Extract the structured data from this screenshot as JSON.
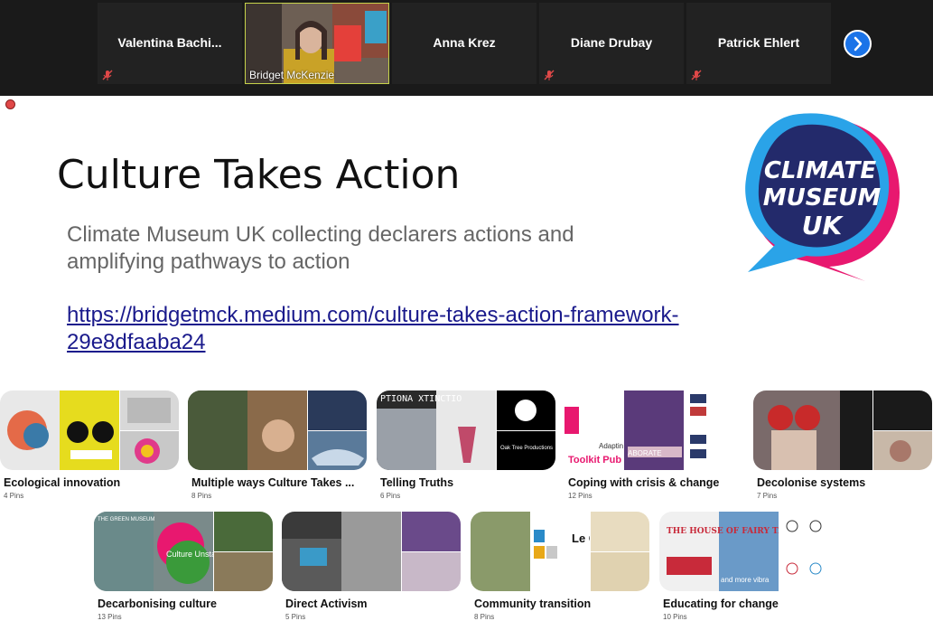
{
  "participants": [
    {
      "name": "Valentina  Bachi...",
      "muted": true
    },
    {
      "name": "Bridget McKenzie",
      "muted": true,
      "video": true
    },
    {
      "name": "Anna Krez",
      "muted": true
    },
    {
      "name": "Diane Drubay",
      "muted": true
    },
    {
      "name": "Patrick Ehlert",
      "muted": true
    }
  ],
  "icons": {
    "mic_muted": "mic-muted-icon",
    "next": "chevron-right-icon",
    "record": "record-icon"
  },
  "slide": {
    "title": "Culture Takes Action",
    "subtitle": "Climate Museum UK collecting declarers actions and amplifying pathways to action",
    "link": "https://bridgetmck.medium.com/culture-takes-action-framework-29e8dfaaba24",
    "logo": {
      "line1": "CLIMATE",
      "line2": "MUSEUM",
      "line3": "UK",
      "colors": {
        "blue": "#2aa3e8",
        "pink": "#e8186f",
        "navy": "#232a6b"
      }
    }
  },
  "boards": [
    {
      "name": "Ecological innovation",
      "pins": "4 Pins"
    },
    {
      "name": "Multiple ways Culture Takes ...",
      "pins": "8 Pins"
    },
    {
      "name": "Telling Truths",
      "pins": "6 Pins"
    },
    {
      "name": "Coping with crisis & change",
      "pins": "12 Pins"
    },
    {
      "name": "Decolonise systems",
      "pins": "7 Pins"
    },
    {
      "name": "Decarbonising culture",
      "pins": "13 Pins"
    },
    {
      "name": "Direct Activism",
      "pins": "5 Pins"
    },
    {
      "name": "Community transition",
      "pins": "8 Pins"
    },
    {
      "name": "Educating for change",
      "pins": "10 Pins"
    }
  ],
  "thumb_text": {
    "b3a": "PTIONA XTINCTIO",
    "b3c": "Oak Tree Productions",
    "b4a": "Toolkit Pub",
    "b4a2": "Adaptin",
    "b4b": "ABORATE",
    "b6a": "THE GREEN MUSEUM",
    "b6b": "Culture Unstained",
    "b8b": "Le Cr Ti",
    "b9a": "THE HOUSE OF FAIRY TALES",
    "b9b": "and more vibra"
  },
  "colors": {
    "accent": "#1a73e8",
    "topbar": "#1a1a1a",
    "link": "#1a1a8c",
    "active_tile_border": "#c7d34a"
  }
}
